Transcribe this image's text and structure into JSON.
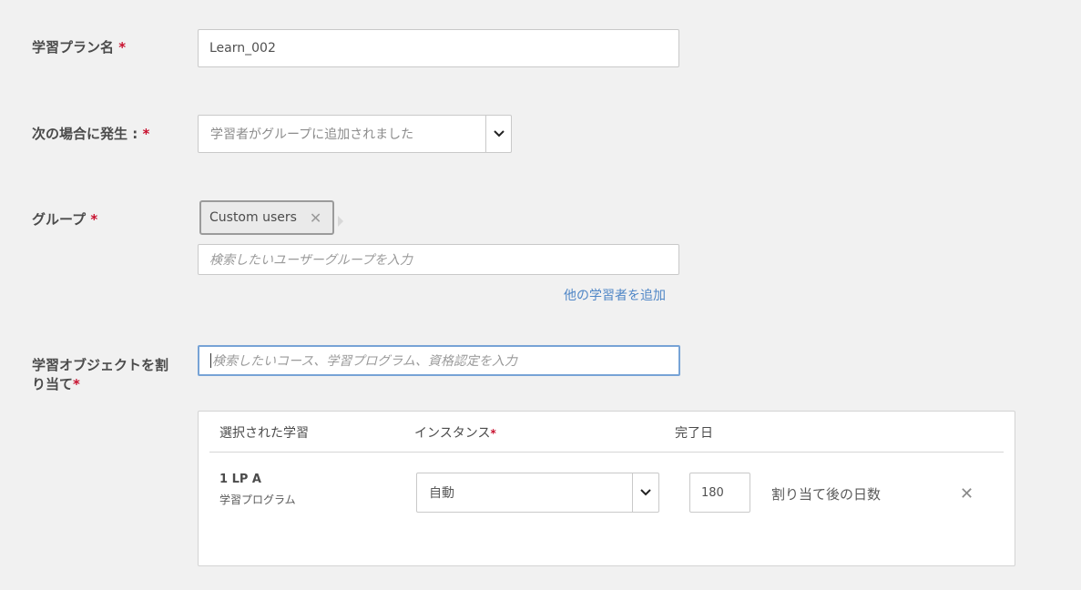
{
  "fields": {
    "plan_name": {
      "label": "学習プラン名",
      "required_mark": "*",
      "value": "Learn_002"
    },
    "trigger": {
      "label": "次の場合に発生 :",
      "required_mark": "*",
      "selected": "学習者がグループに追加されました"
    },
    "group": {
      "label": "グループ",
      "required_mark": "*",
      "chip_label": "Custom users",
      "chip_remove": "✕",
      "search_placeholder": "検索したいユーザーグループを入力",
      "add_link": "他の学習者を追加"
    },
    "assign": {
      "label_line1": "学習オブジェクトを割",
      "label_line2": "り当て",
      "required_mark": "*",
      "search_placeholder": "検索したいコース、学習プログラム、資格認定を入力"
    }
  },
  "table": {
    "headers": {
      "selected": "選択された学習",
      "instance": "インスタンス",
      "instance_required": "*",
      "completion": "完了日"
    },
    "rows": [
      {
        "name": "1 LP A",
        "type": "学習プログラム",
        "instance": "自動",
        "days": "180",
        "days_label": "割り当て後の日数",
        "remove": "✕"
      }
    ]
  },
  "icons": {
    "dropdown": "chevron-down-icon",
    "remove": "close-icon"
  },
  "colors": {
    "required": "#c8102e",
    "link": "#4f86c6",
    "focus_border": "#77a3d6"
  }
}
